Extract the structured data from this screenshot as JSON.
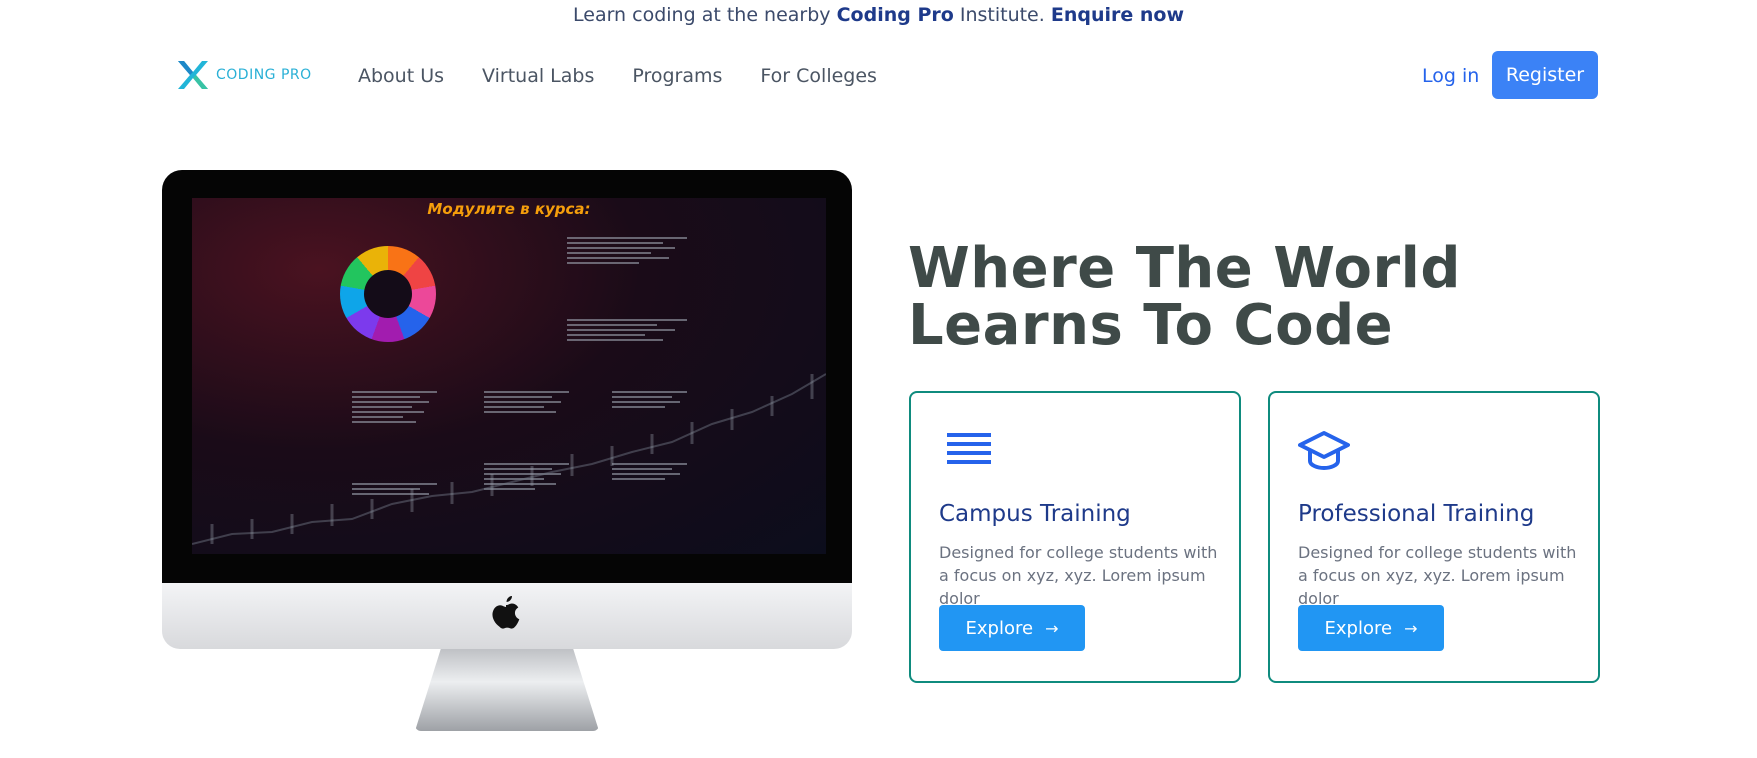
{
  "announcement": {
    "prefix": "Learn coding at the nearby",
    "brand": "Coding Pro",
    "suffix": "Institute.",
    "cta": "Enquire now"
  },
  "logo": {
    "text": "CODING PRO",
    "icon": "x-logo-icon"
  },
  "nav": {
    "items": [
      {
        "label": "About Us"
      },
      {
        "label": "Virtual Labs"
      },
      {
        "label": "Programs"
      },
      {
        "label": "For Colleges"
      }
    ],
    "login": "Log in",
    "register": "Register"
  },
  "hero": {
    "headline_line1": "Where The World",
    "headline_line2": "Learns To Code",
    "slide_title": "Модулите в курса:"
  },
  "cards": [
    {
      "icon": "list-lines-icon",
      "title": "Campus Training",
      "description": "Designed for college students with a focus on xyz, xyz. Lorem ipsum dolor",
      "button": "Explore"
    },
    {
      "icon": "graduation-cap-icon",
      "title": "Professional Training",
      "description": "Designed for college students with a focus on xyz, xyz. Lorem ipsum dolor",
      "button": "Explore"
    }
  ],
  "colors": {
    "primary": "#3b82f6",
    "explore": "#2196f3",
    "card_border": "#0f8b7e",
    "headline": "#3f4a48",
    "title": "#1e3a8a"
  }
}
